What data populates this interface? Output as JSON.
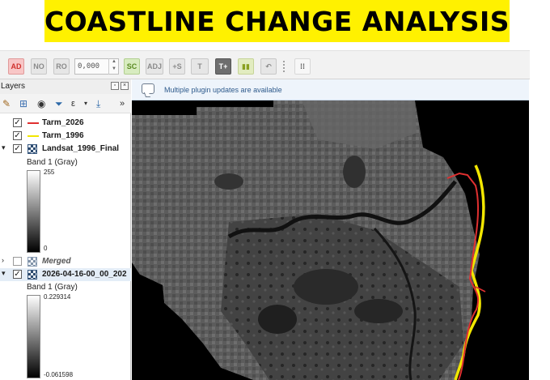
{
  "banner": {
    "title": "COASTLINE CHANGE ANALYSIS"
  },
  "toolbar": {
    "buttons": [
      "AD",
      "NO",
      "RO",
      "SC",
      "ADJ",
      "+S",
      "T",
      "T+"
    ],
    "scale_value": "0,000"
  },
  "layers_panel": {
    "title": "Layers",
    "layers": [
      {
        "name": "Tarm_2026",
        "checked": true,
        "color": "#e03030"
      },
      {
        "name": "Tarm_1996",
        "checked": true,
        "color": "#f2e600"
      },
      {
        "name": "Landsat_1996_Final",
        "checked": true,
        "band": "Band 1 (Gray)",
        "max": "255",
        "min": "0"
      },
      {
        "name": "Merged",
        "checked": false
      },
      {
        "name": "2026-04-16-00_00_202",
        "checked": true,
        "band": "Band 1 (Gray)",
        "max": "0.229314",
        "min": "-0.061598"
      }
    ]
  },
  "map": {
    "message": "Multiple plugin updates are available",
    "coastline_1996_color": "#f2e600",
    "coastline_2026_color": "#e03030"
  }
}
